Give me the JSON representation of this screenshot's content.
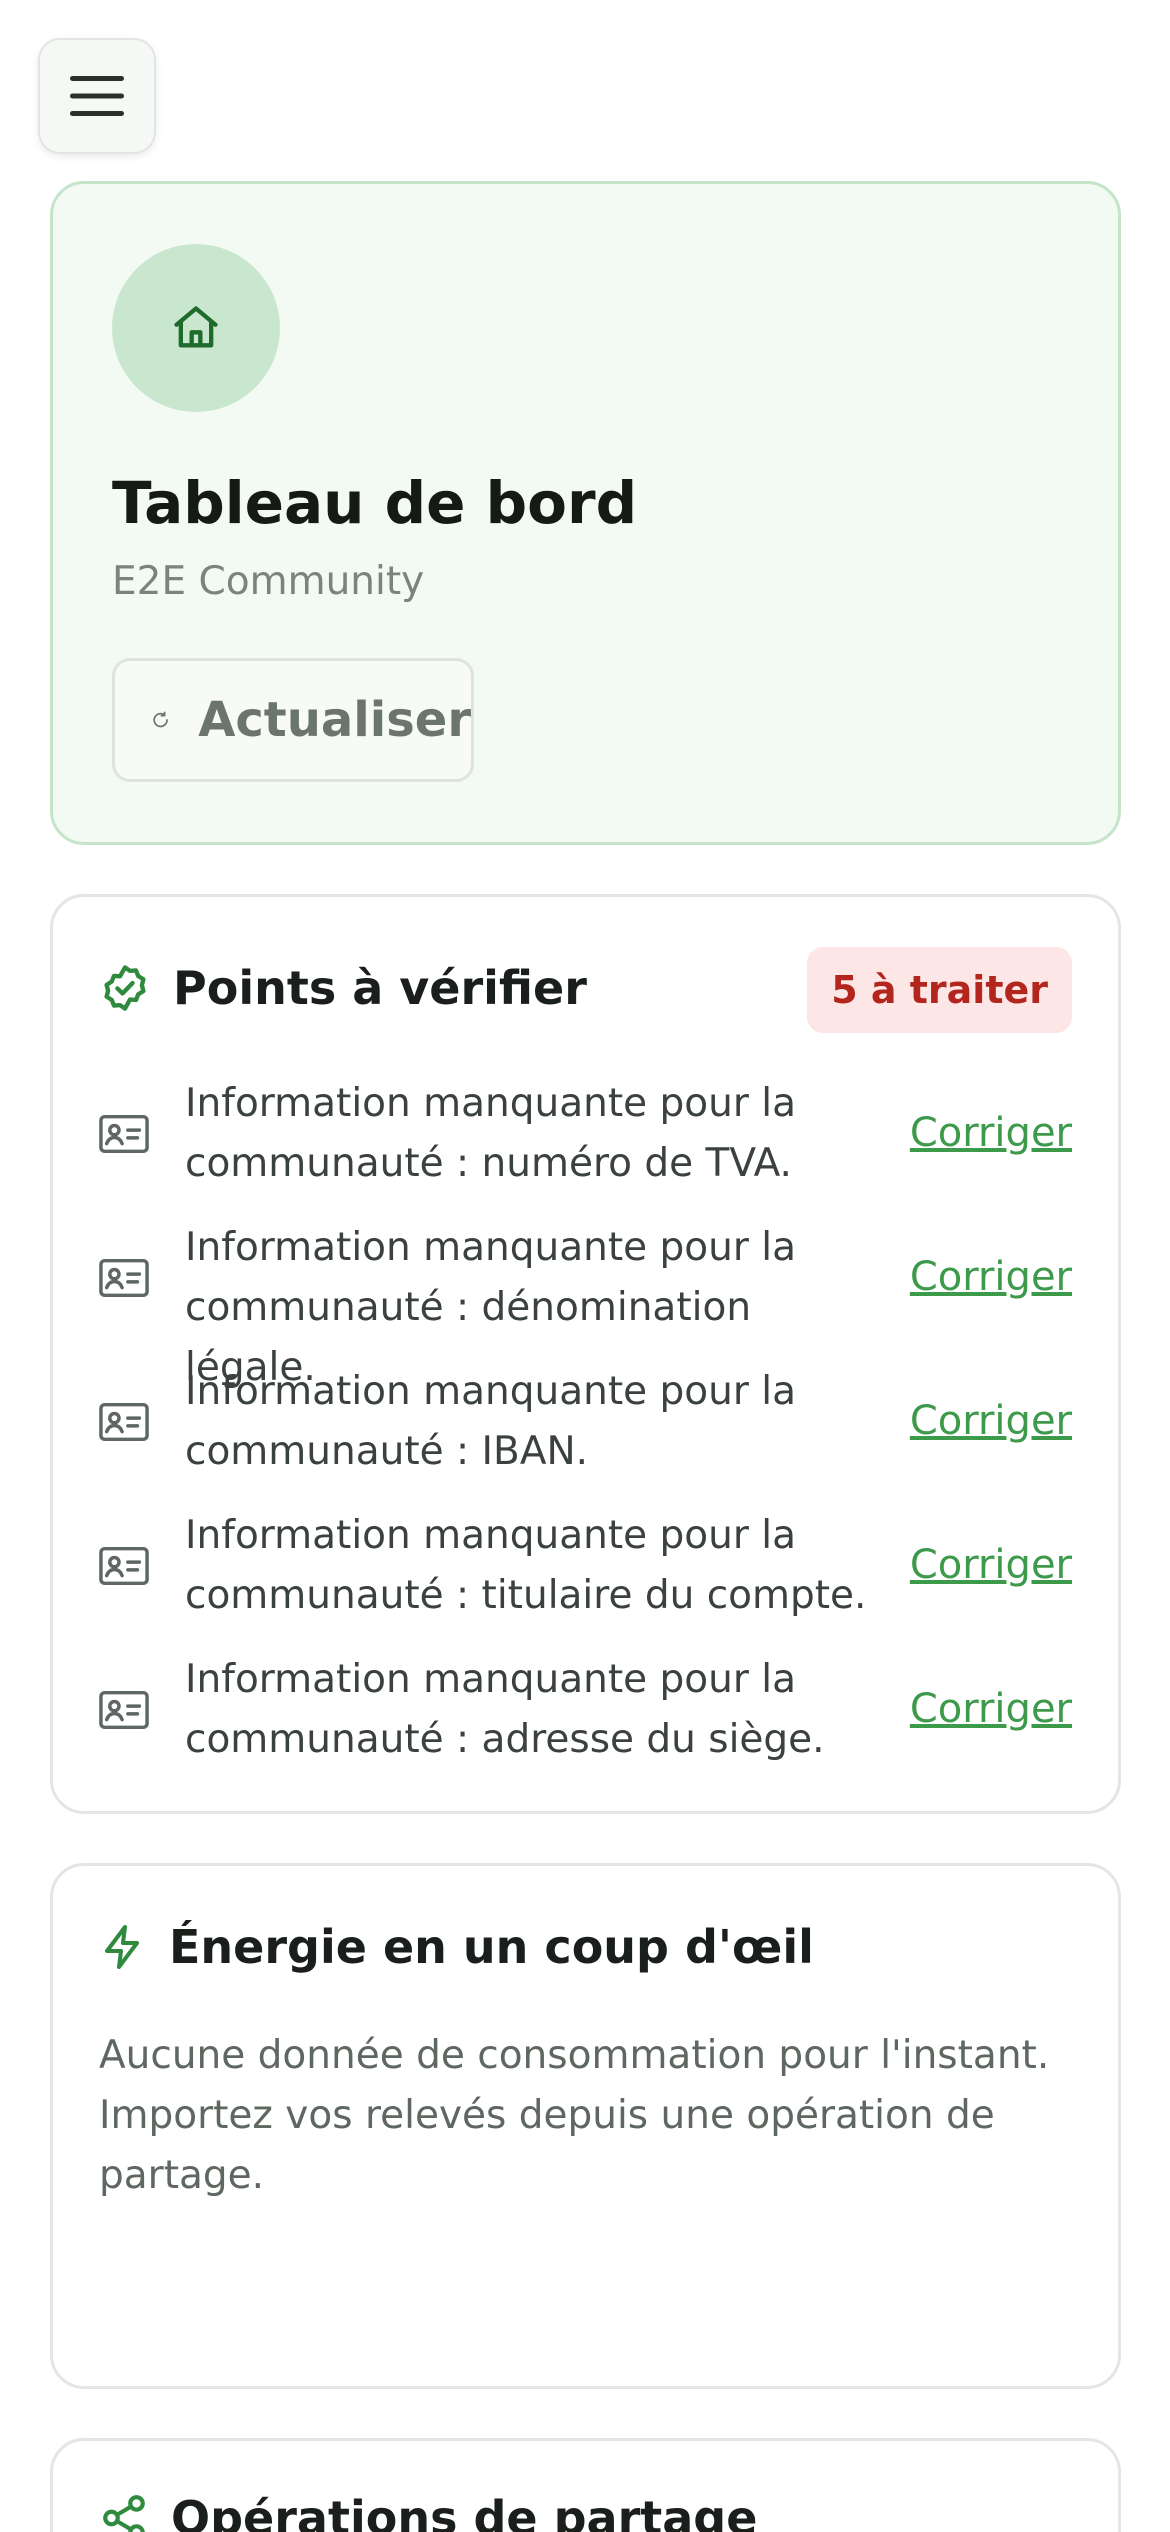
{
  "header": {
    "menu_icon": "hamburger-menu-icon"
  },
  "hero": {
    "icon": "home-icon",
    "title": "Tableau de bord",
    "subtitle": "E2E Community",
    "refresh_label": "Actualiser"
  },
  "checks": {
    "icon": "badge-check-icon",
    "title": "Points à vérifier",
    "badge": "5 à traiter",
    "items": [
      {
        "line1": "Information manquante pour la",
        "line2": "communauté : numéro de TVA.",
        "action": "Corriger"
      },
      {
        "line1": "Information manquante pour la",
        "line2": "communauté : dénomination légale.",
        "action": "Corriger"
      },
      {
        "line1": "Information manquante pour la",
        "line2": "communauté : IBAN.",
        "action": "Corriger"
      },
      {
        "line1": "Information manquante pour la",
        "line2": "communauté : titulaire du compte.",
        "action": "Corriger"
      },
      {
        "line1": "Information manquante pour la",
        "line2": "communauté : adresse du siège.",
        "action": "Corriger"
      }
    ]
  },
  "energy": {
    "icon": "lightning-icon",
    "title": "Énergie en un coup d'œil",
    "empty_text": "Aucune donnée de consommation pour l'instant. Importez vos relevés depuis une opération de partage."
  },
  "operations": {
    "icon": "share-icon",
    "title": "Opérations de partage"
  },
  "colors": {
    "accent": "#3e9a4b",
    "hero_bg": "#f2faf3",
    "badge_bg": "#fde6e6",
    "badge_text": "#b3261e"
  }
}
